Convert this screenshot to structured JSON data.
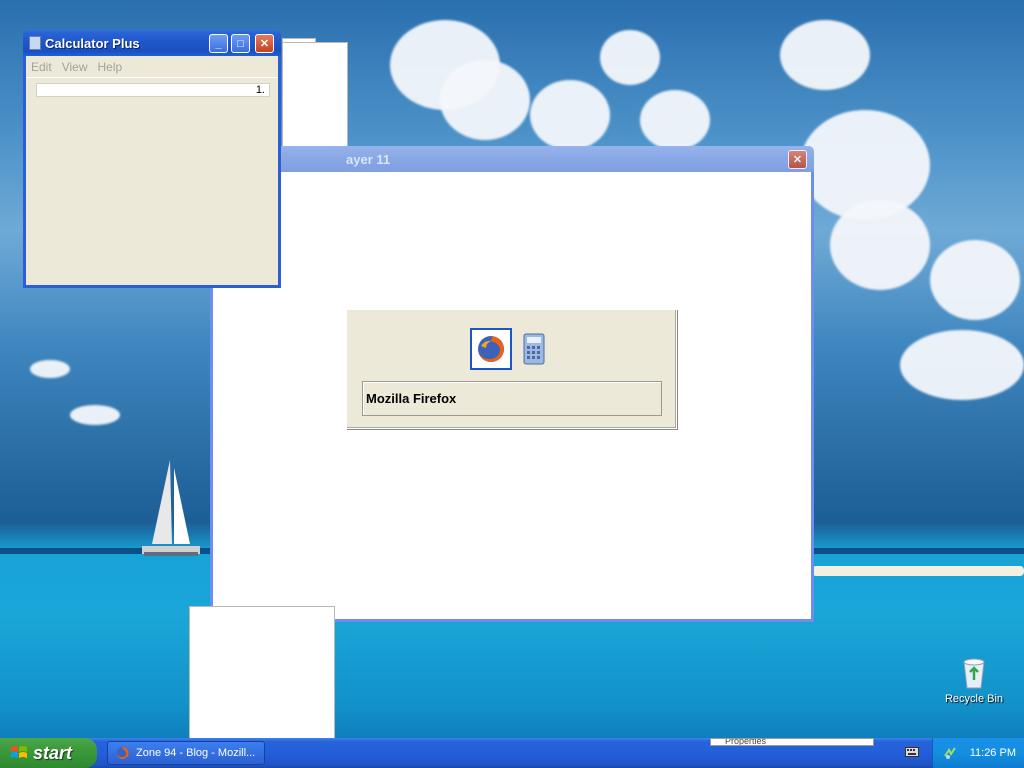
{
  "calculator": {
    "title": "Calculator Plus",
    "menu": [
      "Edit",
      "View",
      "Help"
    ],
    "display_value": "1."
  },
  "player": {
    "title_visible": "ayer 11"
  },
  "alt_tab": {
    "selected_label": "Mozilla Firefox",
    "icons": [
      "firefox-icon",
      "calculator-icon"
    ]
  },
  "desktop": {
    "recycle_bin_label": "Recycle Bin"
  },
  "taskbar": {
    "start_label": "start",
    "task_label": "Zone 94 - Blog - Mozill...",
    "tray_strip_text": "Properties",
    "clock": "11:26 PM"
  },
  "colors": {
    "title_active": "#1f57cc",
    "title_inactive": "#8aa9e6",
    "start_green": "#3c9a3c",
    "taskbar_blue": "#245edb",
    "dialog_face": "#ece9d8"
  }
}
